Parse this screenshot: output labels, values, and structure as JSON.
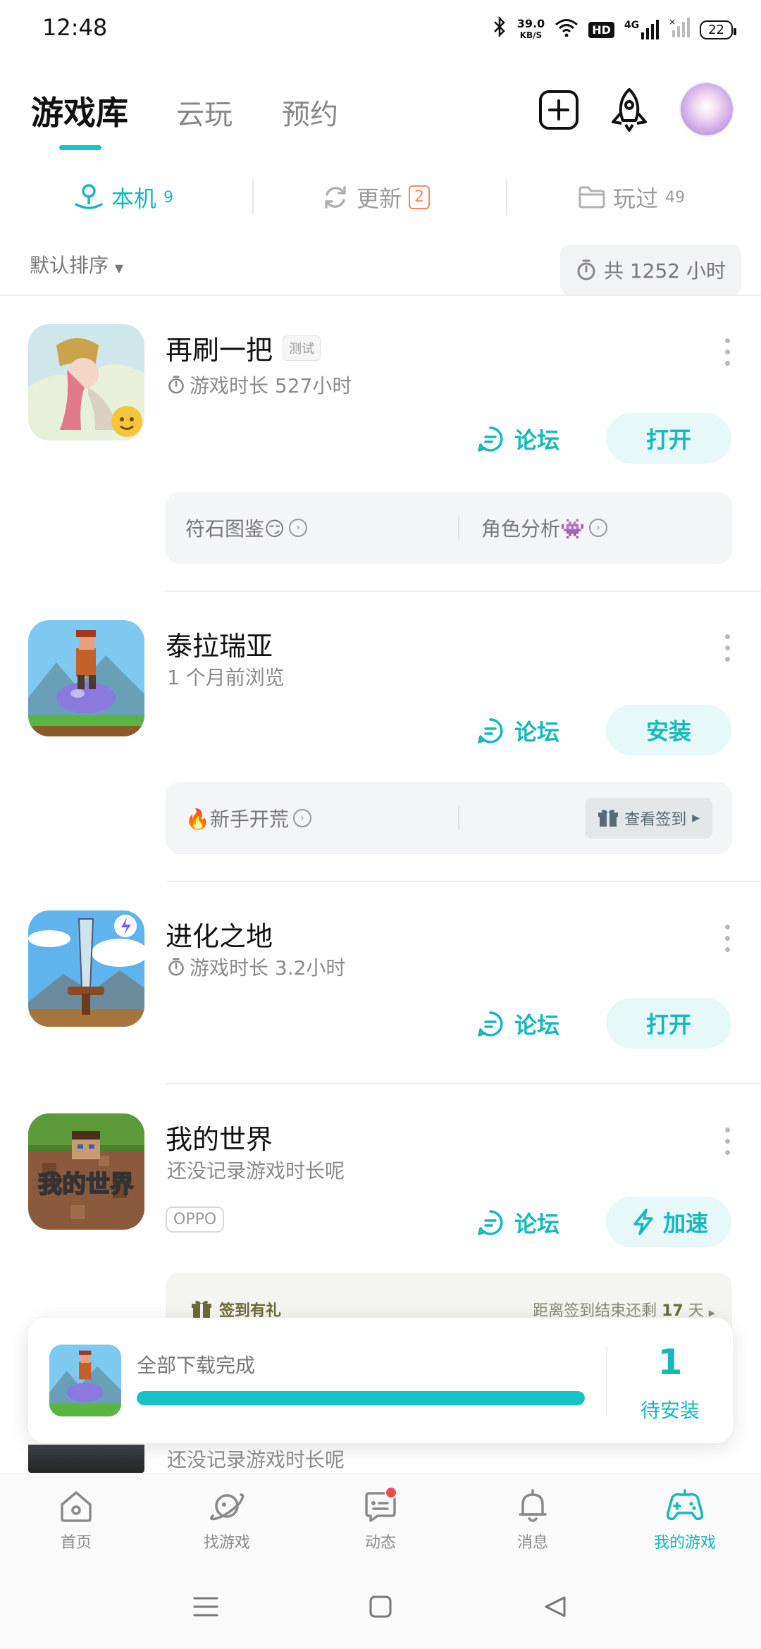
{
  "status_bar": {
    "time": "12:48",
    "network_speed_value": "39.0",
    "network_speed_unit": "KB/S",
    "hd_label": "HD",
    "signal_label": "4G",
    "battery": "22"
  },
  "top_tabs": [
    {
      "label": "游戏库",
      "active": true
    },
    {
      "label": "云玩",
      "active": false
    },
    {
      "label": "预约",
      "active": false
    }
  ],
  "sub_tabs": [
    {
      "label": "本机",
      "count": "9"
    },
    {
      "label": "更新",
      "count": "2"
    },
    {
      "label": "玩过",
      "count": "49"
    }
  ],
  "sort": {
    "label": "默认排序",
    "total_hours": "共 1252 小时"
  },
  "games": [
    {
      "title": "再刷一把",
      "tag": "测试",
      "subtitle": "游戏时长 527小时",
      "forum": "论坛",
      "action": "打开",
      "card_left": "符石图鉴😏",
      "card_right": "角色分析👾"
    },
    {
      "title": "泰拉瑞亚",
      "subtitle": "1 个月前浏览",
      "forum": "论坛",
      "action": "安装",
      "card_left": "🔥新手开荒",
      "card_button": "查看签到"
    },
    {
      "title": "进化之地",
      "subtitle": "游戏时长 3.2小时",
      "forum": "论坛",
      "action": "打开"
    },
    {
      "title": "我的世界",
      "icon_text": "我的世界",
      "subtitle": "还没记录游戏时长呢",
      "oppo_tag": "OPPO",
      "forum": "论坛",
      "action": "加速",
      "gift_label": "签到有礼",
      "gift_countdown_prefix": "距离签到结束还剩",
      "gift_countdown_value": "17",
      "gift_countdown_unit": "天"
    }
  ],
  "download_popup": {
    "title": "全部下载完成",
    "progress": 1.0,
    "count": "1",
    "count_label": "待安装"
  },
  "partial_game": {
    "subtitle": "还没记录游戏时长呢"
  },
  "bottom_nav": [
    {
      "label": "首页",
      "icon": "home-icon"
    },
    {
      "label": "找游戏",
      "icon": "planet-icon"
    },
    {
      "label": "动态",
      "icon": "message-icon"
    },
    {
      "label": "消息",
      "icon": "bell-icon"
    },
    {
      "label": "我的游戏",
      "icon": "gamepad-icon",
      "active": true
    }
  ],
  "colors": {
    "accent": "#16b8bd",
    "badge": "#f08a5d",
    "notification_dot": "#f04b4b"
  }
}
